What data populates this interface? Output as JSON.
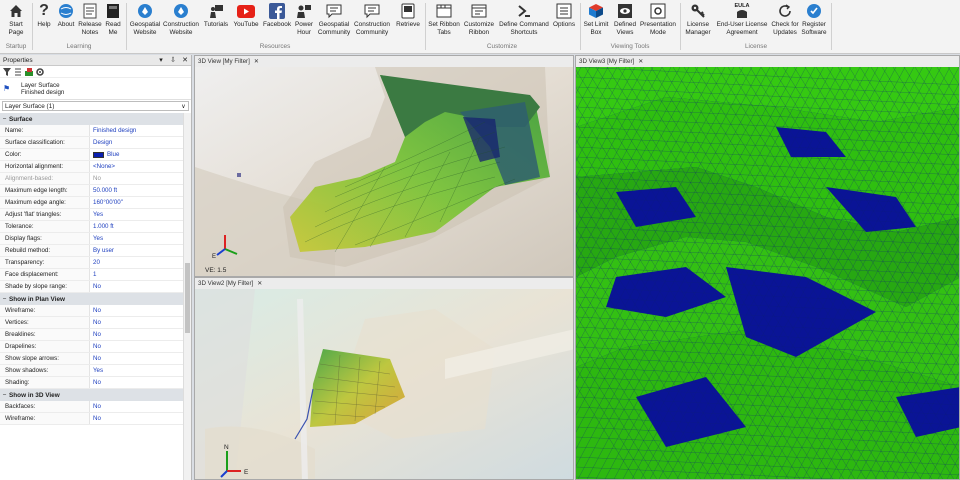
{
  "ribbon": {
    "groups": {
      "startup": "Startup",
      "learning": "Learning",
      "resources": "Resources",
      "customize": "Customize",
      "viewing_tools": "Viewing Tools",
      "license": "License"
    },
    "buttons": {
      "start_page": "Start\nPage",
      "help": "Help",
      "about": "About",
      "release_notes": "Release\nNotes",
      "read_me": "Read\nMe",
      "geospatial_website": "Geospatial\nWebsite",
      "construction_website": "Construction\nWebsite",
      "tutorials": "Tutorials",
      "youtube": "YouTube",
      "facebook": "Facebook",
      "power_hour": "Power\nHour",
      "geospatial_community": "Geospatial\nCommunity",
      "construction_community": "Construction\nCommunity",
      "retrieve": "Retrieve",
      "set_ribbon_tabs": "Set Ribbon\nTabs",
      "customize_ribbon": "Customize\nRibbon",
      "define_command_shortcuts": "Define Command\nShortcuts",
      "options": "Options",
      "set_limit_box": "Set Limit\nBox",
      "defined_views": "Defined\nViews",
      "presentation_mode": "Presentation\nMode",
      "license_manager": "License\nManager",
      "eula": "End-User License\nAgreement",
      "check_updates": "Check for\nUpdates",
      "register": "Register\nSoftware"
    },
    "eula_badge": "EULA"
  },
  "properties": {
    "title": "Properties",
    "pin_glyph": "⇩",
    "close_glyph": "✕",
    "menu_glyph": "▾",
    "object_type": "Layer Surface",
    "object_name": "Finished design",
    "selector": "Layer Surface (1)",
    "sections": [
      {
        "title": "Surface",
        "rows": [
          {
            "k": "Name:",
            "v": "Finished design"
          },
          {
            "k": "Surface classification:",
            "v": "Design"
          },
          {
            "k": "Color:",
            "v": "Blue",
            "swatch": true
          },
          {
            "k": "Horizontal alignment:",
            "v": "<None>"
          },
          {
            "k": "Alignment-based:",
            "v": "No",
            "dim": true
          },
          {
            "k": "Maximum edge length:",
            "v": "50.000 ft"
          },
          {
            "k": "Maximum edge angle:",
            "v": "160°00'00\""
          },
          {
            "k": "Adjust 'flat' triangles:",
            "v": "Yes"
          },
          {
            "k": "Tolerance:",
            "v": "1.000 ft"
          },
          {
            "k": "Display flags:",
            "v": "Yes"
          },
          {
            "k": "Rebuild method:",
            "v": "By user"
          },
          {
            "k": "Transparency:",
            "v": "20"
          },
          {
            "k": "Face displacement:",
            "v": "1"
          },
          {
            "k": "Shade by slope range:",
            "v": "No"
          }
        ]
      },
      {
        "title": "Show in Plan View",
        "rows": [
          {
            "k": "Wireframe:",
            "v": "No"
          },
          {
            "k": "Vertices:",
            "v": "No"
          },
          {
            "k": "Breaklines:",
            "v": "No"
          },
          {
            "k": "Drapelines:",
            "v": "No"
          },
          {
            "k": "Show slope arrows:",
            "v": "No"
          },
          {
            "k": "Show shadows:",
            "v": "Yes"
          },
          {
            "k": "Shading:",
            "v": "No"
          }
        ]
      },
      {
        "title": "Show in 3D View",
        "rows": [
          {
            "k": "Backfaces:",
            "v": "No"
          },
          {
            "k": "Wireframe:",
            "v": "No"
          }
        ]
      }
    ]
  },
  "views": {
    "view1": {
      "tab": "3D View [My Filter]",
      "ve": "VE: 1.5"
    },
    "view2": {
      "tab": "3D View2 [My Filter]"
    },
    "view3": {
      "tab": "3D View3 [My Filter]"
    },
    "close_glyph": "✕",
    "axis_n": "N",
    "axis_e": "E"
  },
  "colors": {
    "terrain_green": "#3cd814",
    "terrain_navy": "#0a1496",
    "accent_blue": "#1e3fbf"
  }
}
